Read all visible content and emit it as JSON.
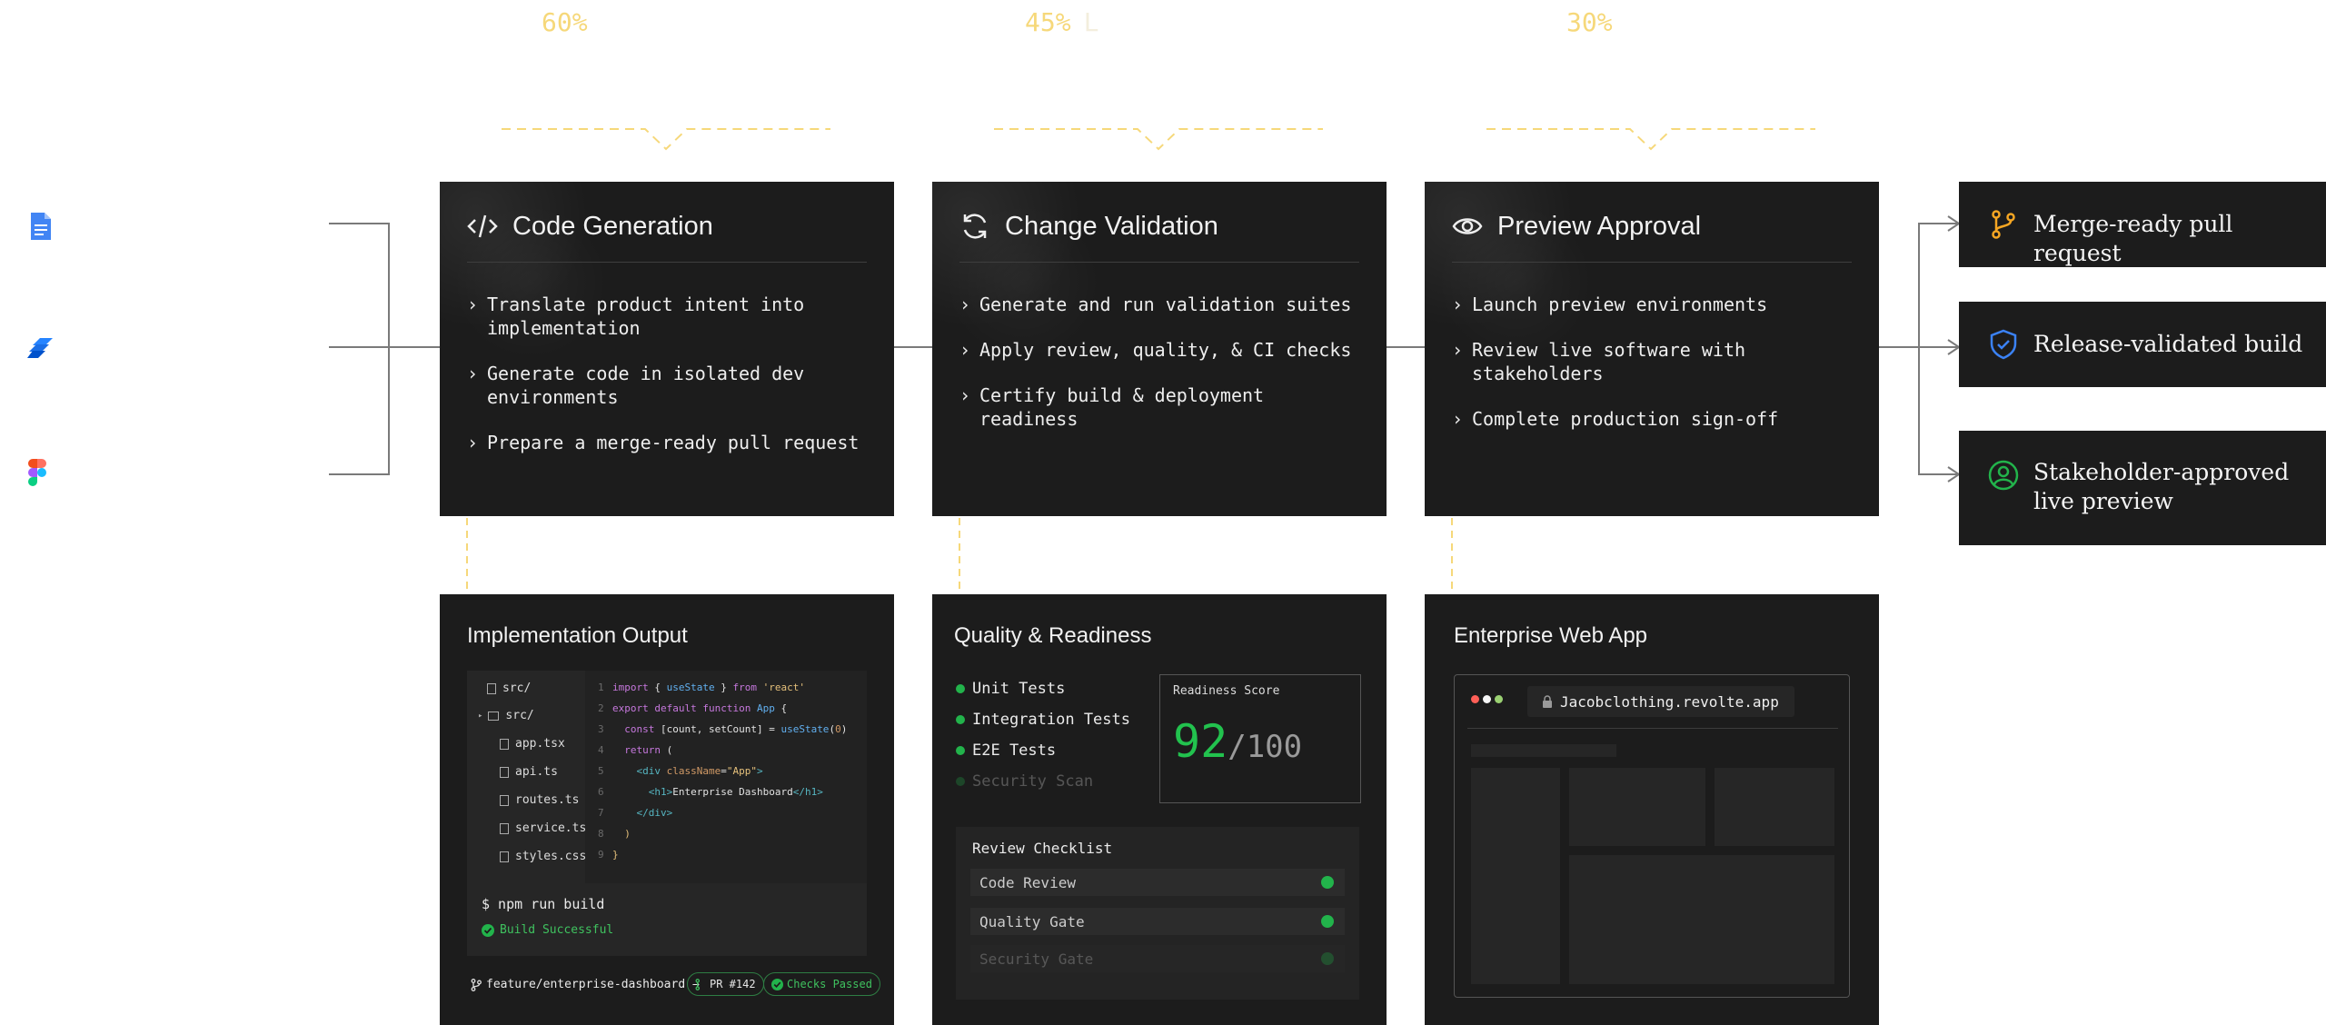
{
  "percentages": [
    "60%",
    "45%",
    "30%"
  ],
  "percentages_ghost": "L",
  "sources": [
    {
      "icon": "google-docs-icon"
    },
    {
      "icon": "jira-icon"
    },
    {
      "icon": "figma-icon"
    }
  ],
  "stages": [
    {
      "title": "Code Generation",
      "icon": "code-icon",
      "bullets": [
        "Translate product intent into\nimplementation",
        "Generate code in isolated dev\nenvironments",
        "Prepare a merge-ready pull request"
      ]
    },
    {
      "title": "Change Validation",
      "icon": "refresh-icon",
      "bullets": [
        "Generate and run validation suites",
        "Apply review, quality, & CI checks",
        "Certify build & deployment\nreadiness"
      ]
    },
    {
      "title": "Preview Approval",
      "icon": "eye-icon",
      "bullets": [
        "Launch preview environments",
        "Review live software with\nstakeholders",
        "Complete production sign-off"
      ]
    }
  ],
  "results": [
    {
      "label": "Merge-ready pull request",
      "icon": "git-branch-icon",
      "color": "#f5a623"
    },
    {
      "label": "Release-validated build",
      "icon": "shield-check-icon",
      "color": "#3b82f6"
    },
    {
      "label": "Stakeholder-approved\nlive preview",
      "icon": "user-circle-icon",
      "color": "#22b34b"
    }
  ],
  "implementation": {
    "title": "Implementation Output",
    "files": [
      "src/",
      "src/",
      "app.tsx",
      "api.ts",
      "routes.ts",
      "service.ts",
      "styles.css"
    ],
    "code_lines": [
      "import { useState } from 'react'",
      "export default function App {",
      "  const [count, setCount] = useState(0)",
      "  return (",
      "    <div className=\"App\">",
      "      <h1>Enterprise Dashboard</h1>",
      "    </div>",
      "  )",
      "}"
    ],
    "command": "$ npm run build",
    "build_status": "Build Successful",
    "branch": "feature/enterprise-dashboard →",
    "pr": "PR #142",
    "checks": "Checks Passed"
  },
  "quality": {
    "title": "Quality & Readiness",
    "tests": [
      "Unit Tests",
      "Integration Tests",
      "E2E Tests",
      "Security Scan"
    ],
    "score_label": "Readiness Score",
    "score": "92",
    "score_max": "/100",
    "checklist_title": "Review Checklist",
    "checklist": [
      "Code Review",
      "Quality Gate",
      "Security Gate"
    ]
  },
  "webapp": {
    "title": "Enterprise Web App",
    "url": "Jacobclothing.revolte.app"
  }
}
